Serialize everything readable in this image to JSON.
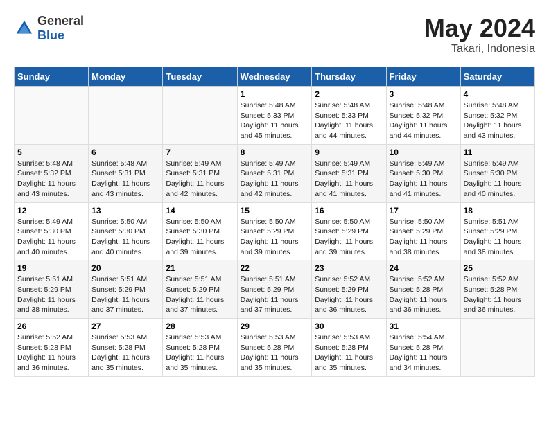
{
  "header": {
    "logo_general": "General",
    "logo_blue": "Blue",
    "title": "May 2024",
    "location": "Takari, Indonesia"
  },
  "days_of_week": [
    "Sunday",
    "Monday",
    "Tuesday",
    "Wednesday",
    "Thursday",
    "Friday",
    "Saturday"
  ],
  "weeks": [
    [
      {
        "num": "",
        "info": ""
      },
      {
        "num": "",
        "info": ""
      },
      {
        "num": "",
        "info": ""
      },
      {
        "num": "1",
        "info": "Sunrise: 5:48 AM\nSunset: 5:33 PM\nDaylight: 11 hours and 45 minutes."
      },
      {
        "num": "2",
        "info": "Sunrise: 5:48 AM\nSunset: 5:33 PM\nDaylight: 11 hours and 44 minutes."
      },
      {
        "num": "3",
        "info": "Sunrise: 5:48 AM\nSunset: 5:32 PM\nDaylight: 11 hours and 44 minutes."
      },
      {
        "num": "4",
        "info": "Sunrise: 5:48 AM\nSunset: 5:32 PM\nDaylight: 11 hours and 43 minutes."
      }
    ],
    [
      {
        "num": "5",
        "info": "Sunrise: 5:48 AM\nSunset: 5:32 PM\nDaylight: 11 hours and 43 minutes."
      },
      {
        "num": "6",
        "info": "Sunrise: 5:48 AM\nSunset: 5:31 PM\nDaylight: 11 hours and 43 minutes."
      },
      {
        "num": "7",
        "info": "Sunrise: 5:49 AM\nSunset: 5:31 PM\nDaylight: 11 hours and 42 minutes."
      },
      {
        "num": "8",
        "info": "Sunrise: 5:49 AM\nSunset: 5:31 PM\nDaylight: 11 hours and 42 minutes."
      },
      {
        "num": "9",
        "info": "Sunrise: 5:49 AM\nSunset: 5:31 PM\nDaylight: 11 hours and 41 minutes."
      },
      {
        "num": "10",
        "info": "Sunrise: 5:49 AM\nSunset: 5:30 PM\nDaylight: 11 hours and 41 minutes."
      },
      {
        "num": "11",
        "info": "Sunrise: 5:49 AM\nSunset: 5:30 PM\nDaylight: 11 hours and 40 minutes."
      }
    ],
    [
      {
        "num": "12",
        "info": "Sunrise: 5:49 AM\nSunset: 5:30 PM\nDaylight: 11 hours and 40 minutes."
      },
      {
        "num": "13",
        "info": "Sunrise: 5:50 AM\nSunset: 5:30 PM\nDaylight: 11 hours and 40 minutes."
      },
      {
        "num": "14",
        "info": "Sunrise: 5:50 AM\nSunset: 5:30 PM\nDaylight: 11 hours and 39 minutes."
      },
      {
        "num": "15",
        "info": "Sunrise: 5:50 AM\nSunset: 5:29 PM\nDaylight: 11 hours and 39 minutes."
      },
      {
        "num": "16",
        "info": "Sunrise: 5:50 AM\nSunset: 5:29 PM\nDaylight: 11 hours and 39 minutes."
      },
      {
        "num": "17",
        "info": "Sunrise: 5:50 AM\nSunset: 5:29 PM\nDaylight: 11 hours and 38 minutes."
      },
      {
        "num": "18",
        "info": "Sunrise: 5:51 AM\nSunset: 5:29 PM\nDaylight: 11 hours and 38 minutes."
      }
    ],
    [
      {
        "num": "19",
        "info": "Sunrise: 5:51 AM\nSunset: 5:29 PM\nDaylight: 11 hours and 38 minutes."
      },
      {
        "num": "20",
        "info": "Sunrise: 5:51 AM\nSunset: 5:29 PM\nDaylight: 11 hours and 37 minutes."
      },
      {
        "num": "21",
        "info": "Sunrise: 5:51 AM\nSunset: 5:29 PM\nDaylight: 11 hours and 37 minutes."
      },
      {
        "num": "22",
        "info": "Sunrise: 5:51 AM\nSunset: 5:29 PM\nDaylight: 11 hours and 37 minutes."
      },
      {
        "num": "23",
        "info": "Sunrise: 5:52 AM\nSunset: 5:29 PM\nDaylight: 11 hours and 36 minutes."
      },
      {
        "num": "24",
        "info": "Sunrise: 5:52 AM\nSunset: 5:28 PM\nDaylight: 11 hours and 36 minutes."
      },
      {
        "num": "25",
        "info": "Sunrise: 5:52 AM\nSunset: 5:28 PM\nDaylight: 11 hours and 36 minutes."
      }
    ],
    [
      {
        "num": "26",
        "info": "Sunrise: 5:52 AM\nSunset: 5:28 PM\nDaylight: 11 hours and 36 minutes."
      },
      {
        "num": "27",
        "info": "Sunrise: 5:53 AM\nSunset: 5:28 PM\nDaylight: 11 hours and 35 minutes."
      },
      {
        "num": "28",
        "info": "Sunrise: 5:53 AM\nSunset: 5:28 PM\nDaylight: 11 hours and 35 minutes."
      },
      {
        "num": "29",
        "info": "Sunrise: 5:53 AM\nSunset: 5:28 PM\nDaylight: 11 hours and 35 minutes."
      },
      {
        "num": "30",
        "info": "Sunrise: 5:53 AM\nSunset: 5:28 PM\nDaylight: 11 hours and 35 minutes."
      },
      {
        "num": "31",
        "info": "Sunrise: 5:54 AM\nSunset: 5:28 PM\nDaylight: 11 hours and 34 minutes."
      },
      {
        "num": "",
        "info": ""
      }
    ]
  ]
}
